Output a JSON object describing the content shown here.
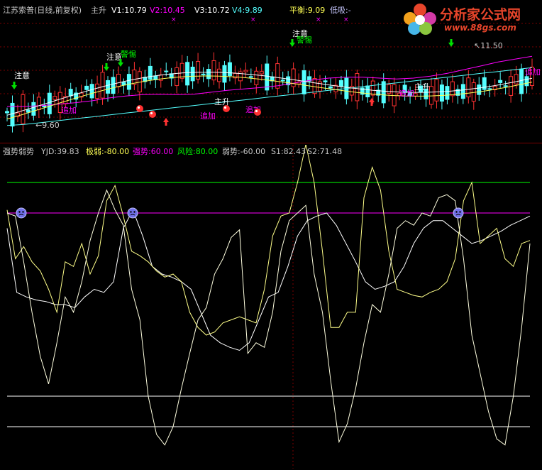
{
  "upper": {
    "title": "江苏索普(日线,前复权)",
    "indicator": "主升",
    "v1": "V1:10.79",
    "v2": "V2:10.45",
    "v3": "V3:10.72",
    "v4": "V4:9.89",
    "balance": "平衡:9.09",
    "low_absorb": "低吸:-",
    "x_mark": "×",
    "signals": {
      "notice": "注意",
      "alert": "警惕",
      "add": "追加",
      "main_rise": "主升",
      "low_value": "9.60",
      "high_value": "11.50",
      "low_prefix": "←",
      "high_prefix": "↖"
    }
  },
  "lower": {
    "title": "强势弱势",
    "yjd": "YJD:39.83",
    "extreme_weak": "极弱:-80.00",
    "strong": "强势:60.00",
    "risk": "风险:80.00",
    "weak": "弱势:-60.00",
    "s1": "S1:82.43",
    "s2": "S2:71.48"
  },
  "logo": {
    "title": "分析家公式网",
    "url": "www.88gs.com"
  },
  "colors": {
    "background": "#000000",
    "up_candle": "#ff3232",
    "down_candle": "#54ffff",
    "ma_white": "#ffffff",
    "ma_yellow": "#ffff54",
    "ma_magenta": "#ff00ff",
    "ma_cyan": "#54ffff",
    "risk_line": "#00ff00",
    "strong_line": "#ff00ff",
    "weak_line": "#ffffff",
    "yjd_line": "#ffffa0",
    "s_line": "#ffffff"
  },
  "chart_data": [
    {
      "type": "line",
      "name": "upper price panel (K-line with moving averages)",
      "series": [
        {
          "name": "V3",
          "values": [
            9.6,
            9.62,
            9.66,
            9.7,
            9.74,
            9.78,
            9.82,
            9.86,
            9.9,
            9.94,
            9.98,
            10.02,
            10.06,
            10.1,
            10.14,
            10.18,
            10.22,
            10.26,
            10.3,
            10.34,
            10.38,
            10.42,
            10.46,
            10.5,
            10.54,
            10.58,
            10.62,
            10.66,
            10.7,
            10.74,
            10.78,
            10.82
          ]
        },
        {
          "name": "V2",
          "values": [
            10.0,
            10.0,
            10.02,
            10.05,
            10.08,
            10.12,
            10.18,
            10.22,
            10.25,
            10.26,
            10.25,
            10.26,
            10.3,
            10.34,
            10.37,
            10.4,
            10.44,
            10.5,
            10.56,
            10.6,
            10.62,
            10.62,
            10.6,
            10.58,
            10.6,
            10.64,
            10.7,
            10.78,
            10.86,
            10.94,
            11.0,
            11.06
          ]
        }
      ],
      "signal_levels": {
        "low": 9.6,
        "high": 11.5
      }
    },
    {
      "type": "line",
      "name": "lower strength panel",
      "ylim": [
        -100,
        100
      ],
      "levels": {
        "风险": 80,
        "强势": 60,
        "弱势": -60,
        "极弱": -80
      },
      "series": [
        {
          "name": "YJD",
          "values": [
            60,
            58,
            28,
            -5,
            -34,
            -52,
            -25,
            5,
            -5,
            15,
            42,
            60,
            75,
            62,
            52,
            10,
            -10,
            -60,
            -85,
            -92,
            -80,
            -55,
            -32,
            -10,
            -2,
            20,
            30,
            44,
            49,
            -32,
            -25,
            -28,
            -5,
            35,
            55,
            60,
            65,
            20,
            -5,
            -50,
            -90,
            -78,
            -55,
            -25,
            0,
            -5,
            20,
            50,
            55,
            52,
            60,
            58,
            70,
            72,
            68,
            30,
            -20,
            -45,
            -70,
            -88,
            -92,
            -60,
            -15,
            40
          ]
        },
        {
          "name": "S1",
          "values": [
            62,
            30,
            38,
            28,
            22,
            10,
            -5,
            28,
            25,
            40,
            20,
            32,
            68,
            78,
            58,
            35,
            32,
            28,
            22,
            18,
            20,
            15,
            -5,
            -15,
            -20,
            -18,
            -12,
            -10,
            -8,
            -10,
            -12,
            10,
            45,
            58,
            60,
            80,
            105,
            80,
            35,
            -15,
            -15,
            -5,
            -5,
            70,
            90,
            75,
            35,
            10,
            8,
            6,
            5,
            8,
            10,
            15,
            30,
            68,
            80,
            40,
            45,
            50,
            30,
            25,
            40,
            42
          ]
        },
        {
          "name": "S2",
          "values": [
            50,
            8,
            5,
            3,
            2,
            0,
            0,
            -2,
            5,
            10,
            8,
            15,
            50,
            62,
            45,
            25,
            20,
            18,
            15,
            10,
            -5,
            -20,
            -25,
            -28,
            -30,
            -25,
            -10,
            5,
            8,
            25,
            45,
            55,
            58,
            60,
            52,
            40,
            28,
            15,
            10,
            12,
            15,
            25,
            40,
            50,
            55,
            55,
            50,
            45,
            40,
            42,
            45,
            48,
            52,
            55,
            58
          ]
        }
      ]
    }
  ]
}
